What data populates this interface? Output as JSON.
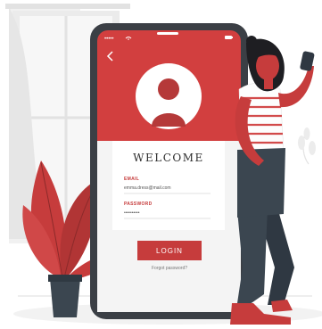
{
  "status_bar": {
    "signal": "•••••",
    "battery_icon": "battery-icon",
    "wifi_icon": "wifi-icon"
  },
  "header": {
    "back_icon": "chevron-left-icon",
    "avatar_icon": "user-avatar-icon"
  },
  "form": {
    "title": "WELCOME",
    "email_label": "EMAIL",
    "email_value": "emma.dress@mail.com",
    "password_label": "PASSWORD",
    "password_value": "••••••••••",
    "login_label": "LOGIN",
    "forgot_label": "Forgot password?"
  },
  "colors": {
    "accent": "#c63c3c",
    "phone_frame": "#3b3f45",
    "wall_gray": "#ececec"
  }
}
